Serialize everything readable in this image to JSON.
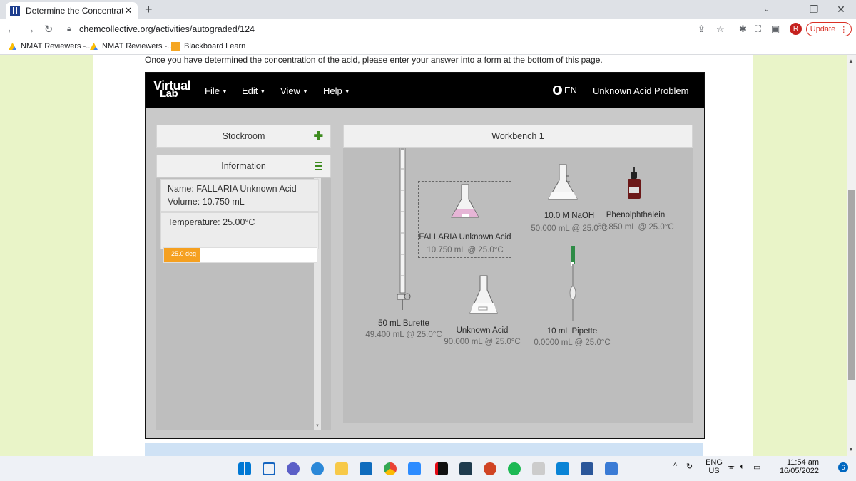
{
  "browser": {
    "tab_title": "Determine the Concentration of",
    "tab_close": "✕",
    "new_tab": "+",
    "url": "chemcollective.org/activities/autograded/124",
    "profile_initial": "R",
    "update_label": "Update"
  },
  "bookmarks": [
    {
      "label": "NMAT Reviewers -...",
      "icon": "google-drive-icon"
    },
    {
      "label": "NMAT Reviewers -...",
      "icon": "google-drive-icon"
    },
    {
      "label": "Blackboard Learn",
      "icon": "blackboard-icon"
    }
  ],
  "page": {
    "instruction": "Once you have determined the concentration of the acid, please enter your answer into a form at the bottom of this page."
  },
  "lab": {
    "logo_top": "Virtual",
    "logo_bottom": "Lab",
    "menus": [
      "File",
      "Edit",
      "View",
      "Help"
    ],
    "language": "EN",
    "problem": "Unknown Acid Problem",
    "stockroom": "Stockroom",
    "information": "Information",
    "info_name": "Name: FALLARIA Unknown Acid",
    "info_volume": "Volume: 10.750 mL",
    "info_temp": "Temperature: 25.00°C",
    "temp_bar_label": "25.0 deg",
    "temp_level": 0.24,
    "workbench": "Workbench 1",
    "items": {
      "naoh_name": "10.0 M NaOH",
      "naoh_sub": "50.000 mL @ 25.0°C",
      "phenol_name": "Phenolphthalein",
      "phenol_sub": "99.850 mL @ 25.0°C",
      "fallaria_name": "FALLARIA Unknown Acid",
      "fallaria_sub": "10.750 mL @ 25.0°C",
      "burette_name": "50 mL Burette",
      "burette_sub": "49.400 mL @ 25.0°C",
      "unknown_name": "Unknown Acid",
      "unknown_sub": "90.000 mL @ 25.0°C",
      "pipette_name": "10 mL Pipette",
      "pipette_sub": "0.0000 mL @ 25.0°C"
    }
  },
  "taskbar": {
    "lang_top": "ENG",
    "lang_bottom": "US",
    "time": "11:54 am",
    "date": "16/05/2022",
    "notifications": "6"
  },
  "colors": {
    "page_bg": "#e9f4c8",
    "lab_bar": "#000000",
    "temp_fill": "#f5a020",
    "accent_plus": "#3d8b1f",
    "update_red": "#d93025",
    "pink_solution": "#e6b5d6"
  }
}
